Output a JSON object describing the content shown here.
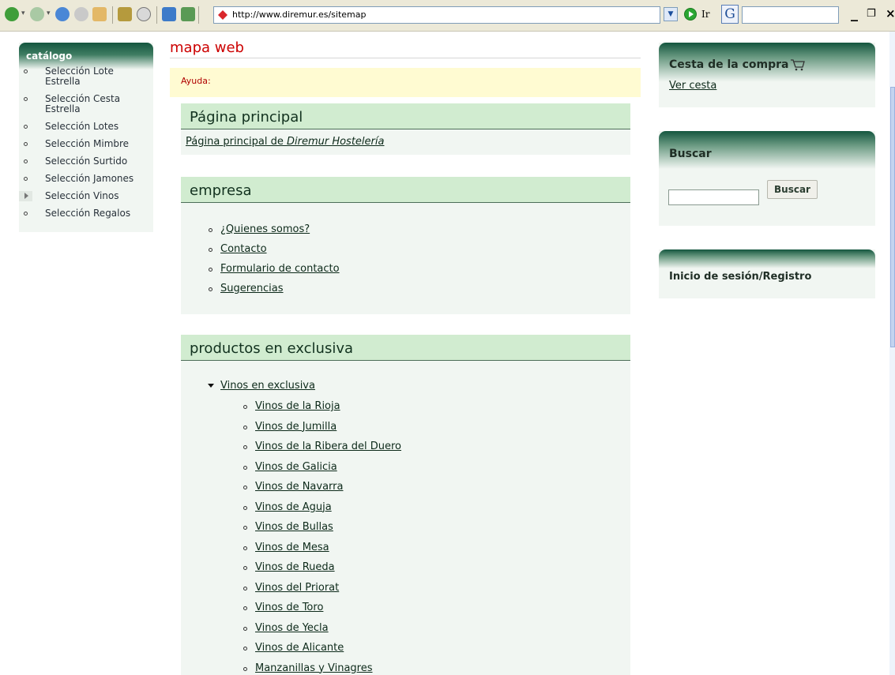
{
  "browser": {
    "url": "http://www.diremur.es/sitemap",
    "go_label": "Ir",
    "google_search_value": ""
  },
  "catalog": {
    "title": "catálogo",
    "items": [
      {
        "label": "Selección Lote\nEstrella",
        "marker": "circle"
      },
      {
        "label": "Selección Cesta\nEstrella",
        "marker": "circle"
      },
      {
        "label": "Selección Lotes",
        "marker": "circle"
      },
      {
        "label": "Selección Mimbre",
        "marker": "circle"
      },
      {
        "label": "Selección Surtido",
        "marker": "circle"
      },
      {
        "label": "Selección Jamones",
        "marker": "circle"
      },
      {
        "label": "Selección Vinos",
        "marker": "arrow"
      },
      {
        "label": "Selección Regalos",
        "marker": "circle"
      }
    ]
  },
  "main": {
    "page_title": "mapa web",
    "help_label": "Ayuda:",
    "sections": {
      "home": {
        "title": "Página principal",
        "link_prefix": "Página principal de ",
        "link_italic": "Diremur Hostelería"
      },
      "empresa": {
        "title": "empresa",
        "links": [
          "¿Quienes somos?",
          "Contacto",
          "Formulario de contacto",
          "Sugerencias"
        ]
      },
      "productos": {
        "title": "productos en exclusiva",
        "parent_link": "Vinos en exclusiva",
        "links": [
          "Vinos de la Rioja",
          "Vinos de Jumilla",
          "Vinos de la Ribera del Duero",
          "Vinos de Galicia",
          "Vinos de Navarra",
          "Vinos de Aguja",
          "Vinos de Bullas",
          "Vinos de Mesa",
          "Vinos de Rueda",
          "Vinos del Priorat",
          "Vinos de Toro",
          "Vinos de Yecla",
          "Vinos de Alicante",
          "Manzanillas y Vinagres"
        ]
      }
    }
  },
  "sidebar": {
    "cart": {
      "title": "Cesta de la compra",
      "view_link": "Ver cesta"
    },
    "search": {
      "title": "Buscar",
      "button_label": "Buscar",
      "input_value": ""
    },
    "login": {
      "title": "Inicio de sesión/Registro"
    }
  },
  "colors": {
    "accent_red": "#cc0000",
    "panel_bg": "#f1f6f2",
    "section_header_bg": "#d1ecd0",
    "header_dark_green": "#14563f",
    "help_bg": "#fffbd2"
  }
}
